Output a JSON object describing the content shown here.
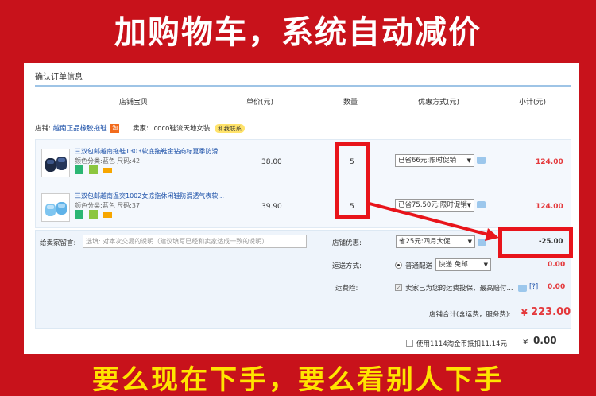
{
  "banner": {
    "title": "加购物车，系统自动减价",
    "bottom": "要么现在下手，要么看别人下手"
  },
  "order": {
    "section_title": "确认订单信息",
    "columns": [
      "店铺宝贝",
      "单价(元)",
      "数量",
      "优惠方式(元)",
      "小计(元)"
    ],
    "shop_label": "店铺:",
    "shop_name": "越南正品橡胶拖鞋",
    "shop_badge": "淘",
    "seller_label": "卖家:",
    "seller_name": "coco鞋流天地女装",
    "chat_label": "和我联系",
    "items": [
      {
        "title": "三双包邮越南拖鞋1303软底拖鞋金钻商标夏季防滑...",
        "attr": "颜色分类:蓝色  尺码:42",
        "price": "38.00",
        "qty": "5",
        "promo": "已省66元:限时促销",
        "subtotal": "124.00"
      },
      {
        "title": "三双包邮越南温突1002女凉拖休闲鞋防滑透气表软...",
        "attr": "颜色分类:蓝色  尺码:37",
        "price": "39.90",
        "qty": "5",
        "promo": "已省75.50元:限时促销",
        "subtotal": "124.00"
      }
    ],
    "message_label": "给卖家留言:",
    "message_placeholder": "选填: 对本次交易的说明（建议填写已经和卖家达成一致的说明）",
    "shop_discount_label": "店铺优惠:",
    "shop_discount_select": "省25元:四月大促",
    "shop_discount_value": "-25.00",
    "shipping_label": "运送方式:",
    "shipping_option": "普通配送",
    "shipping_select": "快递 免邮",
    "shipping_value": "0.00",
    "insurance_label": "运费险:",
    "insurance_text": "卖家已为您的运费投保，最高赔付...",
    "insurance_help": "[?]",
    "insurance_value": "0.00",
    "total_label": "店铺合计(含运费，服务费):",
    "total_currency": "¥",
    "total_value": "223.00",
    "coin_text": "使用1114淘金币抵扣11.14元",
    "coin_currency": "¥",
    "coin_value": "0.00"
  },
  "colors": {
    "background": "#c8121b",
    "highlight": "#e8141b",
    "price_red": "#e4393c",
    "banner_yellow": "#ffe400"
  }
}
